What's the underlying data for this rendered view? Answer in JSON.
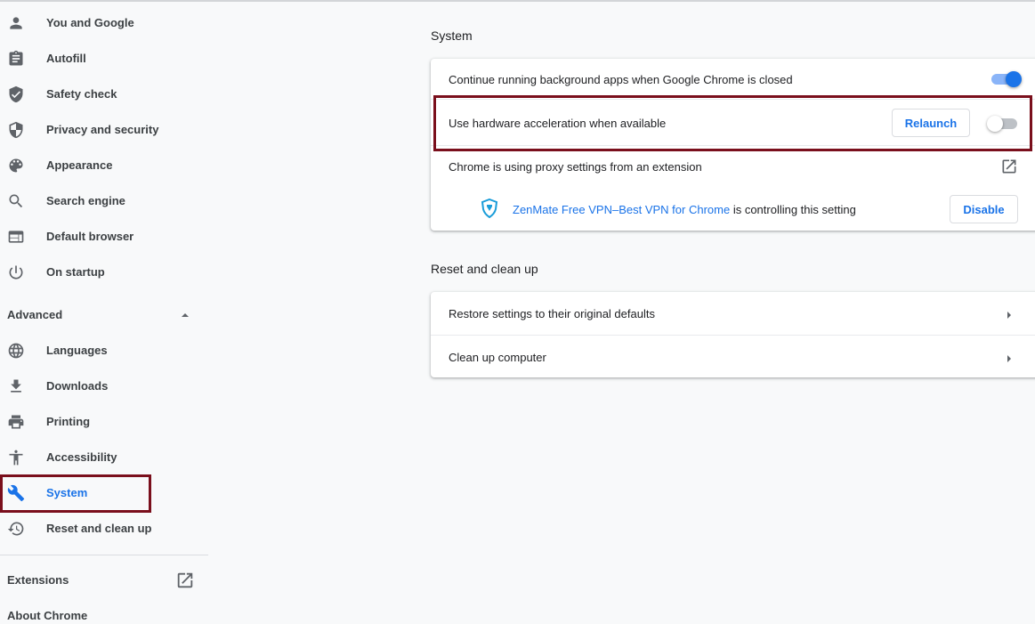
{
  "sidebar": {
    "items": [
      {
        "label": "You and Google",
        "icon": "person-icon"
      },
      {
        "label": "Autofill",
        "icon": "clipboard-icon"
      },
      {
        "label": "Safety check",
        "icon": "shield-check-icon"
      },
      {
        "label": "Privacy and security",
        "icon": "shield-half-icon"
      },
      {
        "label": "Appearance",
        "icon": "palette-icon"
      },
      {
        "label": "Search engine",
        "icon": "search-icon"
      },
      {
        "label": "Default browser",
        "icon": "browser-window-icon"
      },
      {
        "label": "On startup",
        "icon": "power-icon"
      }
    ],
    "advanced_label": "Advanced",
    "advanced_items": [
      {
        "label": "Languages",
        "icon": "globe-icon"
      },
      {
        "label": "Downloads",
        "icon": "download-icon"
      },
      {
        "label": "Printing",
        "icon": "printer-icon"
      },
      {
        "label": "Accessibility",
        "icon": "accessibility-icon"
      },
      {
        "label": "System",
        "icon": "wrench-icon",
        "selected": true
      },
      {
        "label": "Reset and clean up",
        "icon": "history-icon"
      }
    ],
    "extensions_label": "Extensions",
    "about_label": "About Chrome"
  },
  "system": {
    "title": "System",
    "background_apps_label": "Continue running background apps when Google Chrome is closed",
    "background_apps_enabled": true,
    "hw_accel_label": "Use hardware acceleration when available",
    "hw_accel_enabled": false,
    "relaunch_label": "Relaunch",
    "proxy_label": "Chrome is using proxy settings from an extension",
    "extension_link": "ZenMate Free VPN–Best VPN for Chrome",
    "extension_suffix": " is controlling this setting",
    "disable_label": "Disable"
  },
  "reset": {
    "title": "Reset and clean up",
    "restore_label": "Restore settings to their original defaults",
    "cleanup_label": "Clean up computer"
  },
  "colors": {
    "accent": "#1a73e8",
    "highlight": "#7a0f1c"
  }
}
